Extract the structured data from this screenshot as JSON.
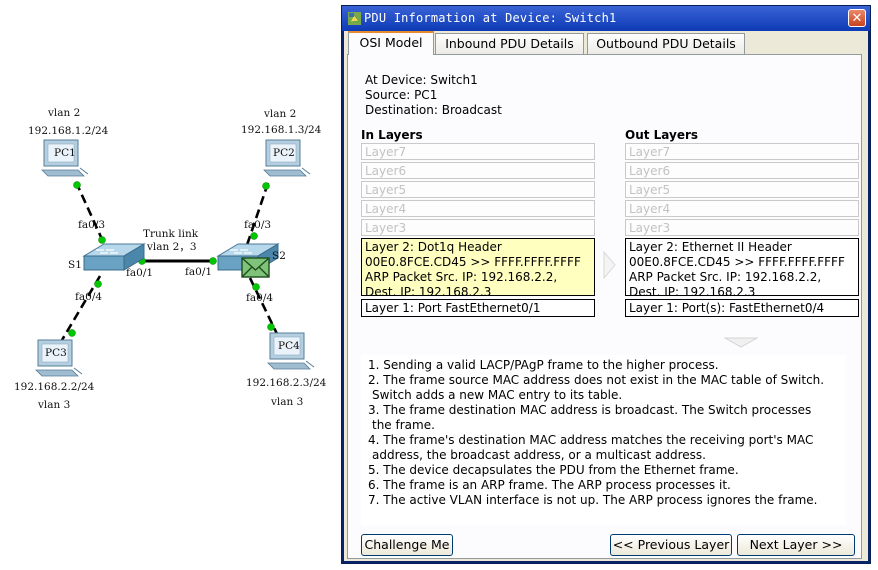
{
  "topology": {
    "trunk_label_1": "Trunk link",
    "trunk_label_2": "vlan 2，3",
    "switches": [
      {
        "name": "S1",
        "port_up": "fa0/3",
        "port_down": "fa0/4",
        "port_trunk": "fa0/1"
      },
      {
        "name": "S2",
        "port_up": "fa0/3",
        "port_down": "fa0/4",
        "port_trunk": "fa0/1"
      }
    ],
    "pcs": [
      {
        "name": "PC1",
        "vlan": "vlan 2",
        "ip": "192.168.1.2/24"
      },
      {
        "name": "PC2",
        "vlan": "vlan 2",
        "ip": "192.168.1.3/24"
      },
      {
        "name": "PC3",
        "vlan": "vlan 3",
        "ip": "192.168.2.2/24"
      },
      {
        "name": "PC4",
        "vlan": "vlan 3",
        "ip": "192.168.2.3/24"
      }
    ],
    "link_color": "#00c800"
  },
  "dialog": {
    "title": "PDU Information at Device: Switch1",
    "close_label": "✕",
    "tabs": [
      {
        "label": "OSI Model",
        "active": true
      },
      {
        "label": "Inbound PDU Details",
        "active": false
      },
      {
        "label": "Outbound PDU Details",
        "active": false
      }
    ],
    "info": {
      "device": "At Device: Switch1",
      "source": "Source: PC1",
      "destination": "Destination: Broadcast"
    },
    "in_layers": {
      "title": "In Layers",
      "inactive": [
        "Layer7",
        "Layer6",
        "Layer5",
        "Layer4",
        "Layer3"
      ],
      "layer2": [
        "Layer 2: Dot1q Header",
        "00E0.8FCE.CD45 >> FFFF.FFFF.FFFF",
        "ARP Packet Src. IP: 192.168.2.2,",
        "Dest. IP: 192.168.2.3"
      ],
      "layer2_bg": "#ffffc0",
      "layer1": "Layer 1: Port FastEthernet0/1"
    },
    "out_layers": {
      "title": "Out Layers",
      "inactive": [
        "Layer7",
        "Layer6",
        "Layer5",
        "Layer4",
        "Layer3"
      ],
      "layer2": [
        "Layer 2: Ethernet II Header",
        "00E0.8FCE.CD45 >> FFFF.FFFF.FFFF",
        "ARP Packet Src. IP: 192.168.2.2,",
        "Dest. IP: 192.168.2.3"
      ],
      "layer2_bg": "#ffffff",
      "layer1": "Layer 1: Port(s): FastEthernet0/4"
    },
    "steps": [
      "1. Sending a valid LACP/PAgP frame to the higher process.",
      "2. The frame source MAC address does not exist in the MAC table of Switch.",
      "Switch adds a new MAC entry to its table.",
      "3. The frame destination MAC address is broadcast. The Switch processes",
      "the frame.",
      "4. The frame's destination MAC address matches the receiving port's MAC",
      "address, the broadcast address, or a multicast address.",
      "5. The device decapsulates the PDU from the Ethernet frame.",
      "6. The frame is an ARP frame. The ARP process processes it.",
      "7. The active VLAN interface is not up. The ARP process ignores the frame."
    ],
    "buttons": {
      "challenge": "Challenge Me",
      "previous": "<< Previous Layer",
      "next": "Next Layer >>"
    }
  }
}
